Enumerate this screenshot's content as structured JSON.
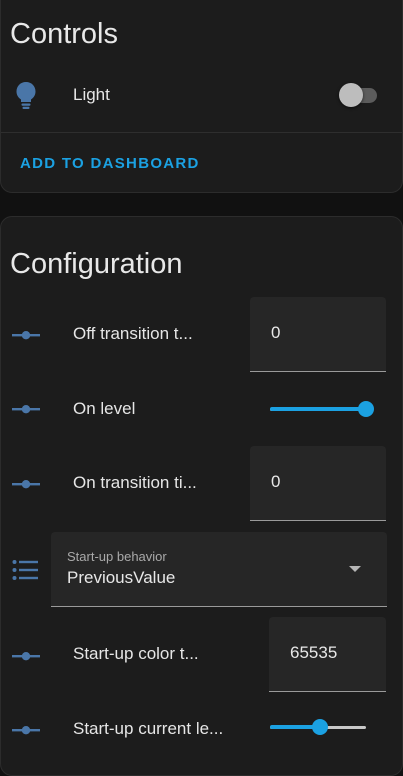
{
  "controls": {
    "title": "Controls",
    "light": {
      "label": "Light",
      "icon": "lightbulb-icon",
      "state": "off"
    },
    "add_button": "ADD TO DASHBOARD"
  },
  "configuration": {
    "title": "Configuration",
    "off_transition": {
      "label": "Off transition t...",
      "value": "0"
    },
    "on_level": {
      "label": "On level",
      "level": 1.0
    },
    "on_transition": {
      "label": "On transition ti...",
      "value": "0"
    },
    "startup_behavior": {
      "label": "Start-up behavior",
      "value": "PreviousValue"
    },
    "startup_color": {
      "label": "Start-up color t...",
      "value": "65535"
    },
    "startup_current_level": {
      "label": "Start-up current le...",
      "level": 0.52
    }
  },
  "colors": {
    "accent": "#1ba1e2",
    "icon": "#4a76a8",
    "background": "#111111",
    "card": "#1c1c1c"
  }
}
